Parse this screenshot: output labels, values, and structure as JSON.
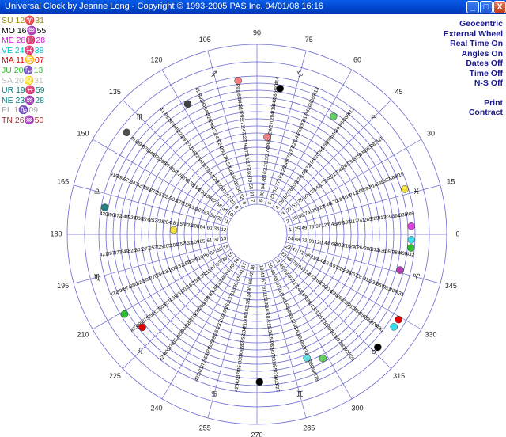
{
  "window": {
    "title": "Universal Clock by Jeanne Long - Copyright © 1993-2005 PAS Inc.  04/01/08 16:16",
    "buttons": [
      "_",
      "□",
      "X"
    ]
  },
  "planets": [
    {
      "text": "SU 12♈31",
      "color": "#9a8a00"
    },
    {
      "text": "MO 16♒55",
      "color": "#000000"
    },
    {
      "text": "ME 28♓28",
      "color": "#e010e0"
    },
    {
      "text": "VE 24♓38",
      "color": "#00c0d0"
    },
    {
      "text": "MA 11♋07",
      "color": "#e00000"
    },
    {
      "text": "JU 20♑13",
      "color": "#30c030"
    },
    {
      "text": "SA 20♌31",
      "color": "#c0c0c0"
    },
    {
      "text": "UR 19♓59",
      "color": "#008080"
    },
    {
      "text": "NE 23♒28",
      "color": "#008080"
    },
    {
      "text": "PL 1♑09",
      "color": "#a0a0a0"
    },
    {
      "text": "TN 26♒50",
      "color": "#a03030"
    }
  ],
  "menu": {
    "items": [
      "Geocentric",
      "External Wheel",
      "Real Time On",
      "Angles On",
      "Dates Off",
      "Time Off",
      "N-S Off"
    ],
    "actions": [
      "Print",
      "Contract"
    ]
  },
  "wheel": {
    "degree_labels": [
      0,
      15,
      30,
      45,
      60,
      75,
      90,
      105,
      120,
      135,
      150,
      165,
      180,
      195,
      210,
      225,
      240,
      255,
      270,
      285,
      300,
      315,
      330,
      345
    ],
    "sign_glyphs": [
      "♓",
      "♒",
      "♑",
      "♐",
      "♏",
      "♎",
      "♍",
      "♌",
      "♋",
      "♊",
      "♉",
      "♈"
    ],
    "ring_offsets": [
      0,
      24,
      48,
      72,
      96,
      120,
      144,
      168,
      192,
      216,
      240,
      264,
      288,
      312,
      336,
      360,
      384,
      408,
      432
    ],
    "markers": [
      {
        "angle": 97,
        "ring": 17,
        "color": "#f08080"
      },
      {
        "angle": 81,
        "ring": 16,
        "color": "#000000"
      },
      {
        "angle": 57,
        "ring": 15,
        "color": "#60d060"
      },
      {
        "angle": 84,
        "ring": 9,
        "color": "#f08080"
      },
      {
        "angle": 17,
        "ring": 17,
        "color": "#f0e040"
      },
      {
        "angle": 3,
        "ring": 17,
        "color": "#e040e0"
      },
      {
        "angle": -2,
        "ring": 17,
        "color": "#40e0f0"
      },
      {
        "angle": -5,
        "ring": 17,
        "color": "#30c030"
      },
      {
        "angle": 118,
        "ring": 16,
        "color": "#404040"
      },
      {
        "angle": 142,
        "ring": 18,
        "color": "#505050"
      },
      {
        "angle": 170,
        "ring": 17,
        "color": "#208080"
      },
      {
        "angle": 177,
        "ring": 7,
        "color": "#f0e040"
      },
      {
        "angle": -14,
        "ring": 16,
        "color": "#b040b0"
      },
      {
        "angle": -31,
        "ring": 18,
        "color": "#e00000"
      },
      {
        "angle": -34,
        "ring": 18,
        "color": "#30e0f0"
      },
      {
        "angle": -43,
        "ring": 18,
        "color": "#000000"
      },
      {
        "angle": 211,
        "ring": 17,
        "color": "#30c030"
      },
      {
        "angle": 219,
        "ring": 16,
        "color": "#e00000"
      },
      {
        "angle": 271,
        "ring": 16,
        "color": "#000000"
      },
      {
        "angle": 292,
        "ring": 14,
        "color": "#60e0e0"
      },
      {
        "angle": 298,
        "ring": 15,
        "color": "#60d060"
      }
    ]
  }
}
